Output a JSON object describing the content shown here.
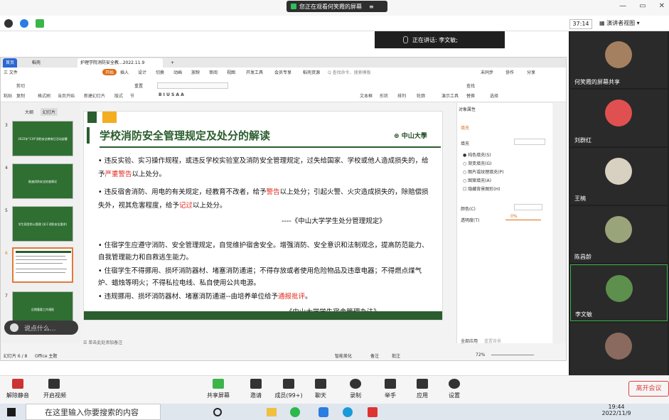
{
  "topbar": {
    "share_notice": "您正在观看何笑霞的屏幕",
    "menu_icon": "hamburger-icon"
  },
  "window_controls": {
    "minimize": "—",
    "restore": "▭",
    "close": "✕"
  },
  "meeting_header": {
    "timer": "37:14",
    "presenter_view": "演讲者视图"
  },
  "speaker": {
    "label": "正在讲话: 李文敏;"
  },
  "wps": {
    "tabs": [
      {
        "label": "首页"
      },
      {
        "label": "稻壳"
      },
      {
        "label": "护理学院消防安全教...2022.11.9"
      }
    ],
    "menu": [
      "三 文件",
      "开始",
      "插入",
      "设计",
      "切换",
      "动画",
      "放映",
      "审阅",
      "视图",
      "开发工具",
      "会员专享",
      "稻壳资源",
      "Q 查找命令、搜索模板"
    ],
    "menu_right": [
      "未同步",
      "协作",
      "分享"
    ],
    "ribbon": [
      "剪切",
      "粘贴",
      "复制",
      "格式刷",
      "当页开始",
      "新建幻灯片",
      "版式",
      "节",
      "重置",
      "文本框",
      "形状",
      "排列",
      "轮廓",
      "演示工具",
      "替换",
      "选择",
      "查找"
    ],
    "left_tabs": {
      "outline": "大纲",
      "slides": "幻灯片"
    },
    "thumbnails": [
      {
        "num": "3",
        "title": "2022年\"119\"消防安全教育日活动部署"
      },
      {
        "num": "4",
        "title": "推遍消防安全检查情况"
      },
      {
        "num": "5",
        "title": "学生宿舍防火管理 (关于消防安全要求)"
      },
      {
        "num": "6",
        "title": ""
      },
      {
        "num": "7",
        "title": "近期重要工作通报"
      }
    ],
    "slide": {
      "title": "学校消防安全管理规定及处分的解读",
      "logo": "中山大學",
      "p1_a": "• 违反实验、实习操作规程，或违反学校实验室及消防安全管理规定，过失给国家、学校或他人造成损失的，给予",
      "p1_red": "严重警告",
      "p1_b": "以上处分。",
      "p2_a": "• 违反宿舍消防、用电的有关规定，经教育不改者，给予",
      "p2_red1": "警告",
      "p2_b": "以上处分；引起火警、火灾造成损失的，除赔偿损失外，视其危害程度，给予",
      "p2_red2": "记过",
      "p2_c": "以上处分。",
      "cite1": "----《中山大学学生处分管理规定》",
      "p3": "• 住宿学生应遵守消防、安全管理规定，自觉维护宿舍安全。增强消防、安全意识和法制观念，提高防范能力、自我管理能力和自救逃生能力。",
      "p4": "• 住宿学生不得挪用、损坏消防器材、堵塞消防通道；不得存放或者使用危险物品及违章电器；不得燃点煤气炉、蜡烛等明火；不得私拉电线、私自使用公共电源。",
      "p5_a": "• 违规挪用、损坏消防器材、堵塞消防通道--由培养单位给予",
      "p5_red": "通报批评",
      "p5_b": "。",
      "cite2": "----《中山大学学生宿舍管理办法》"
    },
    "notes_placeholder": "单击此处添加备注",
    "status": {
      "slide_count": "幻灯片 6 / 8",
      "theme": "Office 主题",
      "smart": "智能美化",
      "notes": "备注",
      "comments": "批注",
      "zoom": "72%"
    },
    "props": {
      "title": "对象属性",
      "tab": "填充",
      "section": "填充",
      "options": [
        "纯色填充(S)",
        "渐变填充(G)",
        "图片或纹理填充(P)",
        "图案填充(A)",
        "隐藏背景图形(H)"
      ],
      "color_label": "颜色(C)",
      "transparency_label": "透明度(T)",
      "transparency_value": "0%",
      "apply_all": "全部应用",
      "reset_bg": "重置背景"
    }
  },
  "chat": {
    "placeholder": "说点什么..."
  },
  "participants": [
    {
      "name": "何笑霞的屏幕共享",
      "color": "#a58060"
    },
    {
      "name": "刘群红",
      "color": "#e05050"
    },
    {
      "name": "王楠",
      "color": "#d8d0c0"
    },
    {
      "name": "陈昌龄",
      "color": "#9aa47a"
    },
    {
      "name": "李文敏",
      "color": "#5d8f4d"
    },
    {
      "name": "",
      "color": "#8a6a5e"
    }
  ],
  "meeting_toolbar": [
    {
      "label": "解除静音",
      "icon": "mic-muted-icon"
    },
    {
      "label": "开启视频",
      "icon": "camera-off-icon"
    },
    {
      "label": "共享屏幕",
      "icon": "share-screen-icon"
    },
    {
      "label": "邀请",
      "icon": "invite-icon"
    },
    {
      "label": "成员(99+)",
      "icon": "members-icon"
    },
    {
      "label": "聊天",
      "icon": "chat-icon"
    },
    {
      "label": "录制",
      "icon": "record-icon"
    },
    {
      "label": "举手",
      "icon": "hand-icon"
    },
    {
      "label": "应用",
      "icon": "apps-icon"
    },
    {
      "label": "设置",
      "icon": "settings-icon"
    }
  ],
  "leave_button": "离开会议",
  "taskbar": {
    "search_placeholder": "在这里输入你要搜索的内容",
    "time": "19:44",
    "date": "2022/11/9"
  }
}
